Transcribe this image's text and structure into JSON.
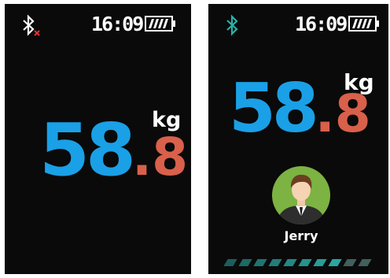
{
  "colors": {
    "screen_bg": "#0a0a0a",
    "weight_integer": "#1aa0e6",
    "weight_decimal": "#d9604a",
    "text": "#ffffff",
    "bluetooth_connected": "#2ab0a8",
    "bluetooth_disconnected_mark": "#e23030",
    "avatar_bg": "#7cb342",
    "progress_active": "#2aa6a0"
  },
  "screens": [
    {
      "status_bar": {
        "bluetooth_icon": "bluetooth-disconnected-icon",
        "time": "16:09",
        "battery_icon": "battery-full-icon"
      },
      "weight": {
        "integer": "58",
        "decimal": ".8",
        "unit": "kg"
      }
    },
    {
      "status_bar": {
        "bluetooth_icon": "bluetooth-connected-icon",
        "time": "16:09",
        "battery_icon": "battery-full-icon"
      },
      "weight": {
        "integer": "58",
        "decimal": ".8",
        "unit": "kg"
      },
      "user": {
        "avatar_icon": "user-avatar-icon",
        "name": "Jerry"
      },
      "progress": {
        "segments_total": 10,
        "segments_filled": 8
      }
    }
  ]
}
